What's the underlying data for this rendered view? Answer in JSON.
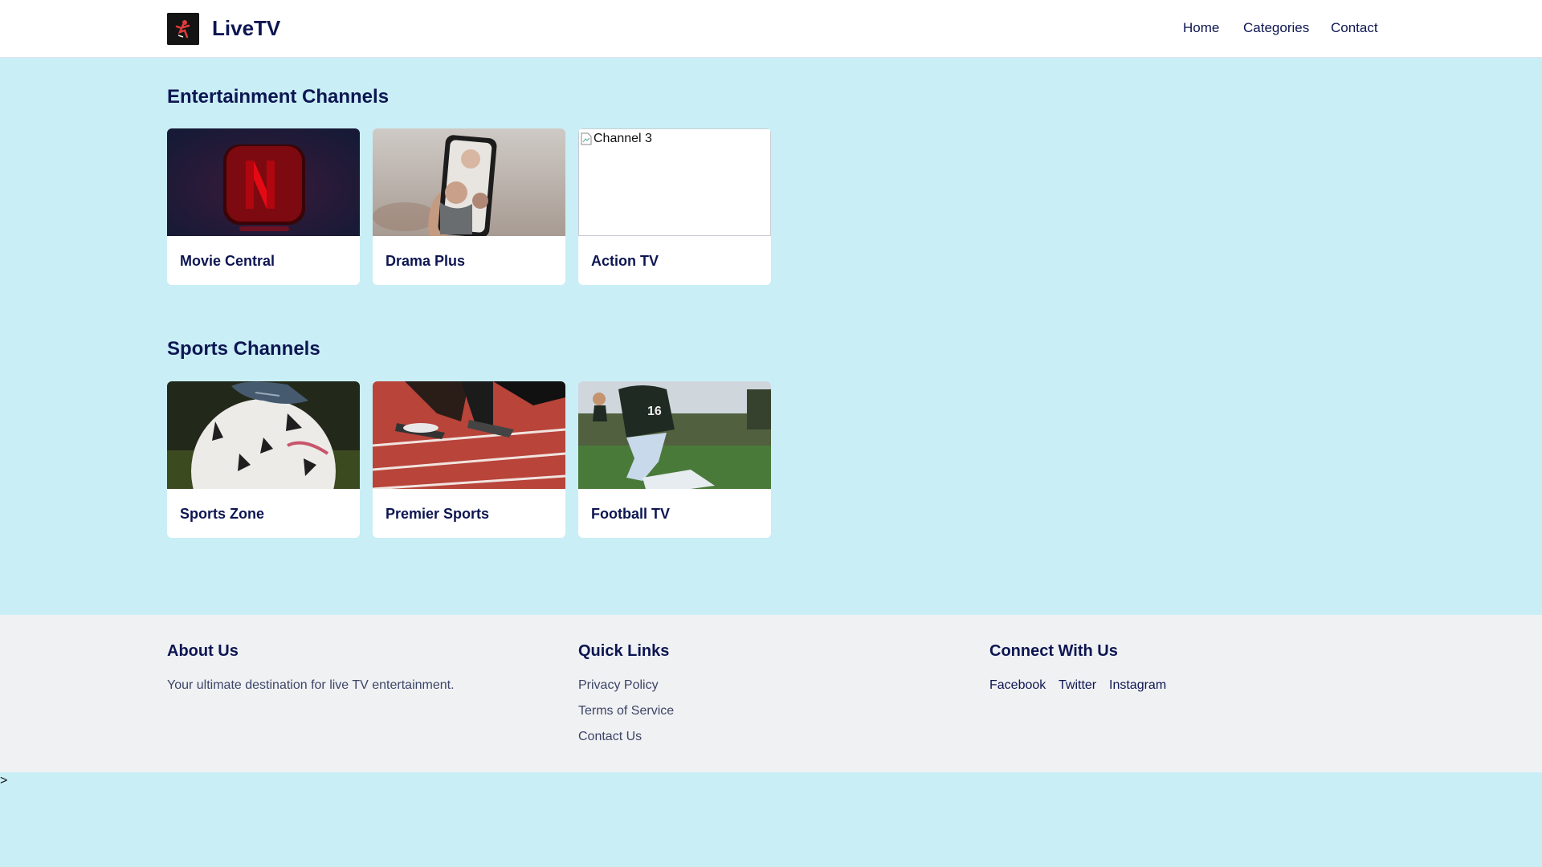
{
  "header": {
    "brand": "LiveTV",
    "nav": [
      "Home",
      "Categories",
      "Contact"
    ]
  },
  "sections": [
    {
      "title": "Entertainment Channels",
      "cards": [
        {
          "title": "Movie Central",
          "image": "netflix-logo-image"
        },
        {
          "title": "Drama Plus",
          "image": "phone-video-call-image"
        },
        {
          "title": "Action TV",
          "image": "broken-image",
          "alt": "Channel 3"
        }
      ]
    },
    {
      "title": "Sports Channels",
      "cards": [
        {
          "title": "Sports Zone",
          "image": "soccer-ball-image"
        },
        {
          "title": "Premier Sports",
          "image": "sprinter-track-image"
        },
        {
          "title": "Football TV",
          "image": "football-player-image"
        }
      ]
    }
  ],
  "footer": {
    "about": {
      "title": "About Us",
      "text": "Your ultimate destination for live TV entertainment."
    },
    "quick_links": {
      "title": "Quick Links",
      "items": [
        "Privacy Policy",
        "Terms of Service",
        "Contact Us"
      ]
    },
    "connect": {
      "title": "Connect With Us",
      "items": [
        "Facebook",
        "Twitter",
        "Instagram"
      ]
    }
  },
  "stray_text": ">",
  "colors": {
    "background": "#c9eef6",
    "header_bg": "#ffffff",
    "footer_bg": "#f0f1f3",
    "text": "#0d1652"
  }
}
